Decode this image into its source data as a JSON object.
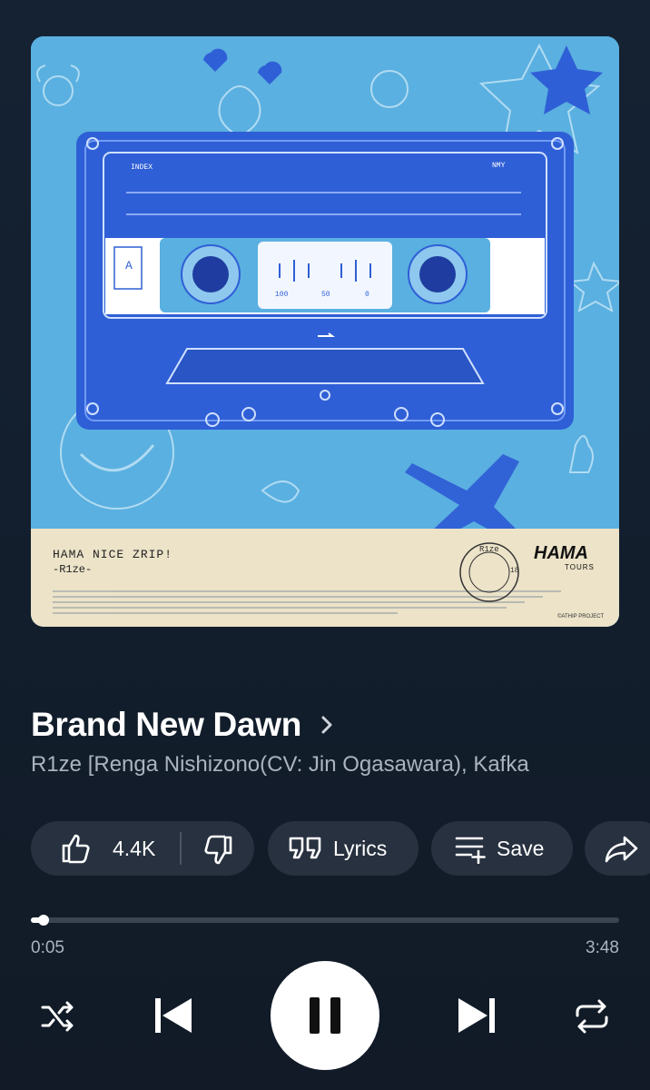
{
  "album_art": {
    "title_text": "HAMA NICE ZRIP!",
    "artist_text": "-R1ze-",
    "brand_text": "HAMA",
    "brand_sub": "TOURS",
    "copyright_text": "©ATHIP PROJECT",
    "tape_side": "A",
    "tape_label_left": "INDEX",
    "tape_label_right": "NMY",
    "counter_numbers": [
      "100",
      "50",
      "0"
    ],
    "stamp_text": "R1ze",
    "stamp_number": "18"
  },
  "song": {
    "title": "Brand New Dawn",
    "artist": "R1ze [Renga Nishizono(CV: Jin Ogasawara), Kafka"
  },
  "actions": {
    "like_count": "4.4K",
    "lyrics_label": "Lyrics",
    "save_label": "Save"
  },
  "playback": {
    "current_time": "0:05",
    "duration": "3:48",
    "progress_fraction": 0.022,
    "state": "playing"
  },
  "icons": {
    "like": "thumbs-up-icon",
    "dislike": "thumbs-down-icon",
    "lyrics": "quote-icon",
    "save": "playlist-add-icon",
    "share": "share-icon",
    "shuffle": "shuffle-icon",
    "previous": "skip-previous-icon",
    "pause": "pause-icon",
    "next": "skip-next-icon",
    "repeat": "repeat-icon"
  },
  "colors": {
    "background": "#131f2e",
    "chip": "#27313f",
    "art_sky": "#5ab0e0",
    "cassette": "#2f5fd6",
    "label_paper": "#ece3c8"
  }
}
